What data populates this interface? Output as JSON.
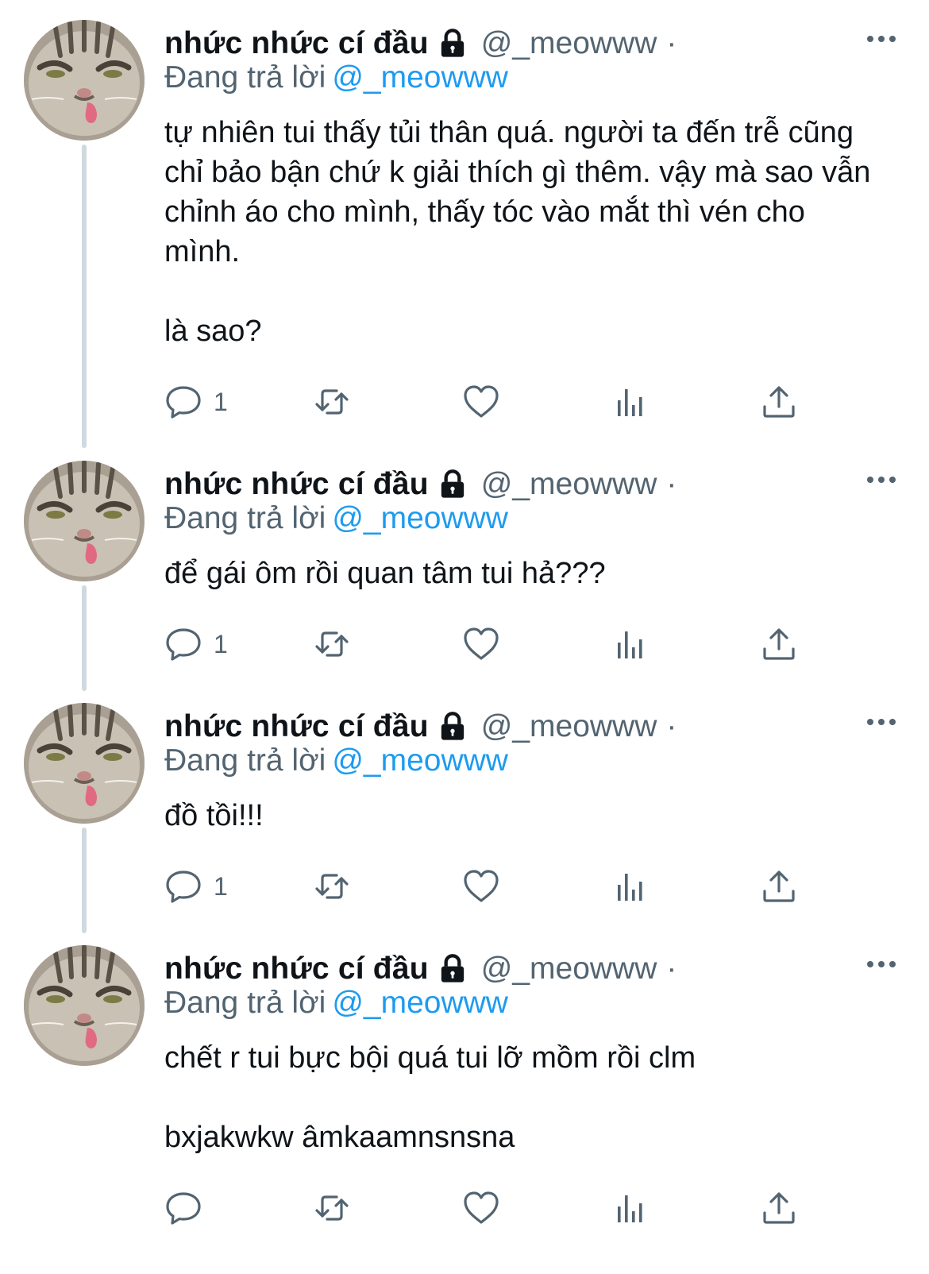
{
  "colors": {
    "text_primary": "#0f1419",
    "text_secondary": "#536471",
    "mention_blue": "#1d9bf0",
    "thread_line": "#cfd9de"
  },
  "icons": {
    "lock": "lock-icon",
    "more": "more-dots-icon",
    "reply": "speech-bubble-icon",
    "retweet": "retweet-arrows-icon",
    "like": "heart-icon",
    "views": "bar-chart-icon",
    "share": "share-upload-icon"
  },
  "tweets": [
    {
      "display_name": "nhức nhức cí đầu",
      "handle": "@_meowww",
      "dot": "·",
      "replying_prefix": "Đang trả lời",
      "replying_to": "@_meowww",
      "text": "tự nhiên tui thấy tủi thân quá. người ta đến trễ cũng chỉ bảo bận chứ k giải thích gì thêm. vậy mà sao vẫn chỉnh áo cho mình, thấy tóc vào mắt thì vén cho mình.\n\nlà sao?",
      "reply_count": "1"
    },
    {
      "display_name": "nhức nhức cí đầu",
      "handle": "@_meowww",
      "dot": "·",
      "replying_prefix": "Đang trả lời",
      "replying_to": "@_meowww",
      "text": "để gái ôm rồi quan tâm tui hả???",
      "reply_count": "1"
    },
    {
      "display_name": "nhức nhức cí đầu",
      "handle": "@_meowww",
      "dot": "·",
      "replying_prefix": "Đang trả lời",
      "replying_to": "@_meowww",
      "text": "đồ tồi!!!",
      "reply_count": "1"
    },
    {
      "display_name": "nhức nhức cí đầu",
      "handle": "@_meowww",
      "dot": "·",
      "replying_prefix": "Đang trả lời",
      "replying_to": "@_meowww",
      "text": "chết r tui bực bội quá tui lỡ mồm rồi clm\n\nbxjakwkw âmkaamnsnsna",
      "reply_count": ""
    }
  ]
}
